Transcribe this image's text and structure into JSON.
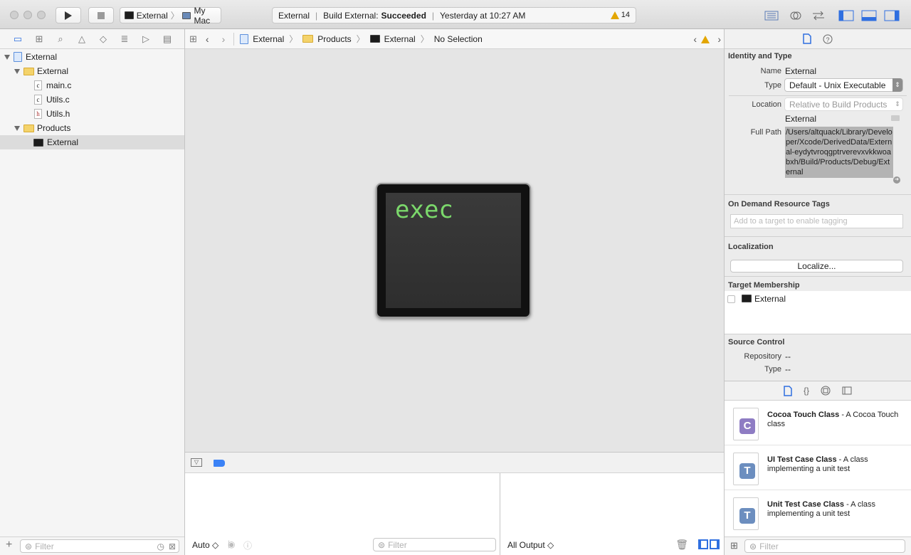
{
  "toolbar": {
    "scheme_name": "External",
    "destination": "My Mac",
    "status_project": "External",
    "status_action": "Build External:",
    "status_result": "Succeeded",
    "status_time": "Yesterday at 10:27 AM",
    "warning_count": "14"
  },
  "navigator": {
    "tree": [
      {
        "label": "External",
        "kind": "project"
      },
      {
        "label": "External",
        "kind": "folder"
      },
      {
        "label": "main.c",
        "kind": "file",
        "badge": "c"
      },
      {
        "label": "Utils.c",
        "kind": "file",
        "badge": "c"
      },
      {
        "label": "Utils.h",
        "kind": "file",
        "badge": "h"
      },
      {
        "label": "Products",
        "kind": "folder"
      },
      {
        "label": "External",
        "kind": "executable"
      }
    ],
    "filter_placeholder": "Filter"
  },
  "jumpbar": {
    "crumbs": [
      "External",
      "Products",
      "External",
      "No Selection"
    ]
  },
  "editor": {
    "preview_text": "exec"
  },
  "debug": {
    "auto_label": "Auto ◇",
    "filter_placeholder": "Filter",
    "output_label": "All Output ◇"
  },
  "inspector": {
    "identity_title": "Identity and Type",
    "name_label": "Name",
    "name_value": "External",
    "type_label": "Type",
    "type_value": "Default - Unix Executable",
    "location_label": "Location",
    "location_value": "Relative to Build Products",
    "location_file": "External",
    "fullpath_label": "Full Path",
    "fullpath_value": "/Users/altquack/Library/Developer/Xcode/DerivedData/External-eydytvroqgptrverevxvkkwoabxh/Build/Products/Debug/External",
    "odr_title": "On Demand Resource Tags",
    "odr_placeholder": "Add to a target to enable tagging",
    "localization_title": "Localization",
    "localize_button": "Localize...",
    "membership_title": "Target Membership",
    "membership_target": "External",
    "source_control_title": "Source Control",
    "repository_label": "Repository",
    "repository_value": "--",
    "sc_type_label": "Type",
    "sc_type_value": "--"
  },
  "library": {
    "items": [
      {
        "title": "Cocoa Touch Class",
        "desc": " - A Cocoa Touch class",
        "badge": "C",
        "color": "#8e7cc3"
      },
      {
        "title": "UI Test Case Class",
        "desc": " - A class implementing a unit test",
        "badge": "T",
        "color": "#6c8ebf"
      },
      {
        "title": "Unit Test Case Class",
        "desc": " - A class implementing a unit test",
        "badge": "T",
        "color": "#6c8ebf"
      }
    ],
    "filter_placeholder": "Filter"
  }
}
